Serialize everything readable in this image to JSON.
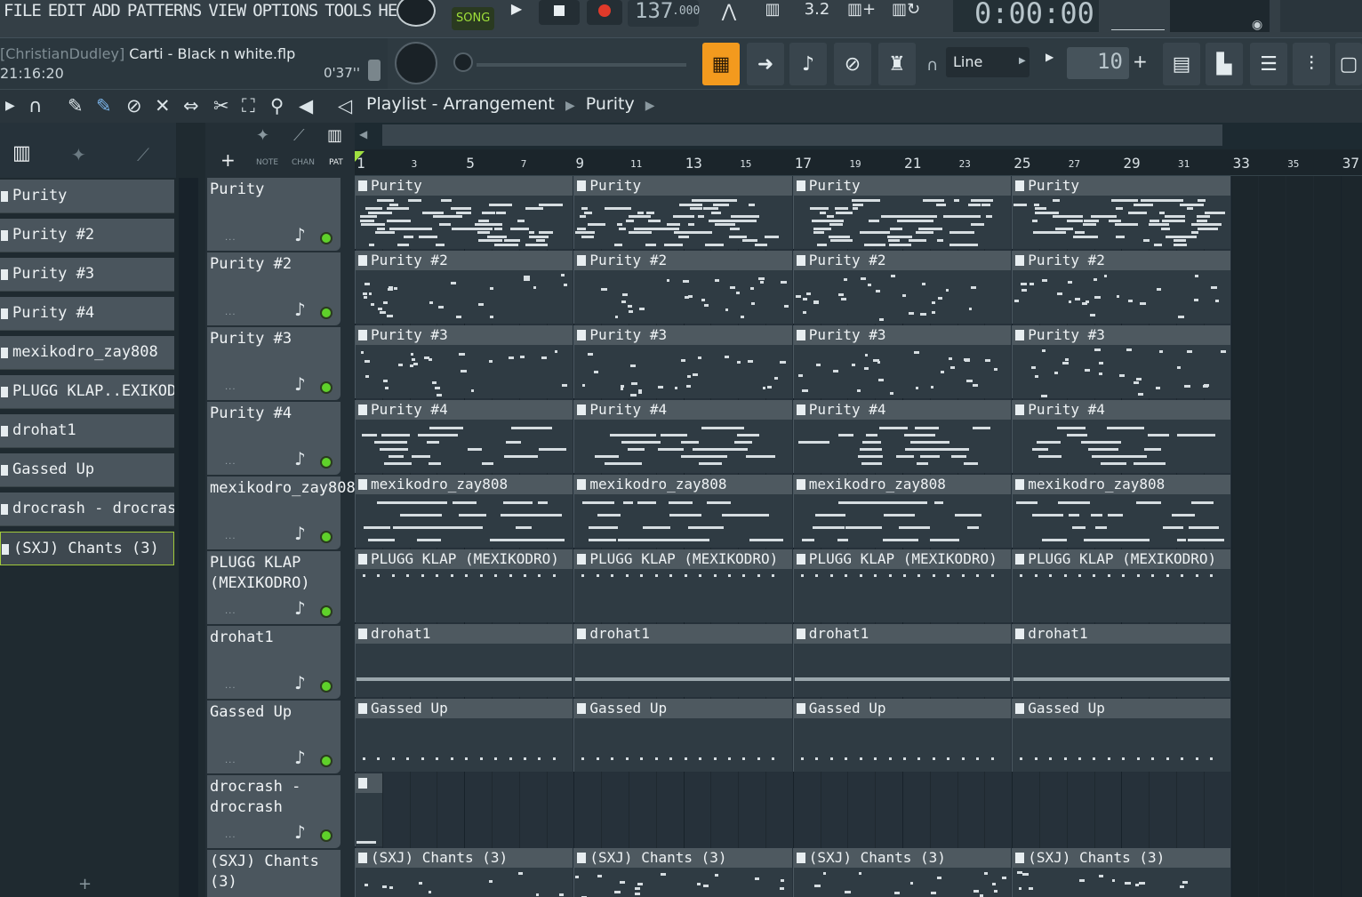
{
  "menu": [
    "FILE",
    "EDIT",
    "ADD",
    "PATTERNS",
    "VIEW",
    "OPTIONS",
    "TOOLS",
    "HELP"
  ],
  "transport": {
    "mode_label": "SONG",
    "tempo_int": "137",
    "tempo_frac": ".000",
    "time": "0:00:00",
    "snap_label": "Line",
    "step_value": "10",
    "pat_label": "PAT"
  },
  "project": {
    "author": "[ChristianDudley]",
    "title": "Carti - Black n white.flp",
    "clock": "21:16:20",
    "duration": "0'37''"
  },
  "playlist": {
    "title": "Playlist - Arrangement",
    "pattern": "Purity"
  },
  "picker": {
    "filter_labels": [
      "NOTE",
      "CHAN",
      "PAT"
    ],
    "items": [
      "Purity",
      "Purity #2",
      "Purity #3",
      "Purity #4",
      "mexikodro_zay808",
      "PLUGG KLAP..EXIKODRO)",
      "drohat1",
      "Gassed Up",
      "drocrash - drocrash",
      "(SXJ) Chants (3)"
    ],
    "selected_index": 9
  },
  "ruler": {
    "bars": [
      "1",
      "3",
      "5",
      "7",
      "9",
      "11",
      "13",
      "15",
      "17",
      "19",
      "21",
      "23",
      "25",
      "27",
      "29",
      "31",
      "33",
      "35",
      "37"
    ]
  },
  "tracks": [
    {
      "name": "Purity",
      "clip_label": "Purity"
    },
    {
      "name": "Purity #2",
      "clip_label": "Purity #2"
    },
    {
      "name": "Purity #3",
      "clip_label": "Purity #3"
    },
    {
      "name": "Purity #4",
      "clip_label": "Purity #4"
    },
    {
      "name": "mexikodro_zay808",
      "clip_label": "mexikodro_zay808"
    },
    {
      "name": "PLUGG KLAP (MEXIKODRO)",
      "clip_label": "PLUGG KLAP (MEXIKODRO)"
    },
    {
      "name": "drohat1",
      "clip_label": "drohat1"
    },
    {
      "name": "Gassed Up",
      "clip_label": "Gassed Up"
    },
    {
      "name": "drocrash - drocrash",
      "clip_label": ""
    },
    {
      "name": "(SXJ) Chants (3)",
      "clip_label": "(SXJ) Chants (3)"
    }
  ],
  "colors": {
    "accent_orange": "#f39a1e",
    "led_green": "#5fd12a",
    "song_green": "#9fe03a",
    "record_red": "#e03a2a"
  },
  "icons": [
    "magnet-icon",
    "pencil-icon",
    "paint-icon",
    "delete-icon",
    "mute-icon",
    "slip-icon",
    "slice-icon",
    "select-icon",
    "zoom-icon",
    "playback-icon",
    "speaker-icon",
    "play-icon",
    "stop-icon",
    "record-icon",
    "metronome-icon",
    "link-icon",
    "plugin-icon",
    "headphone-icon"
  ]
}
